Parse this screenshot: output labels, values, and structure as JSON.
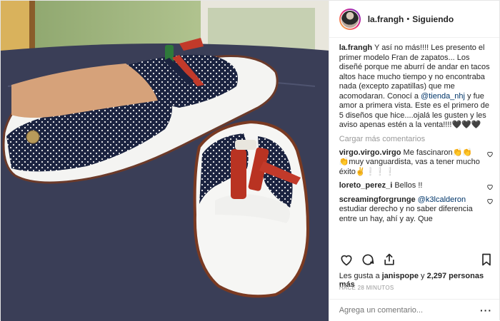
{
  "header": {
    "username": "la.frangh",
    "separator": "•",
    "follow_status": "Siguiendo"
  },
  "caption": {
    "username": "la.frangh",
    "text_1": "Y así no más!!!! Les presento el primer modelo Fran de zapatos... Los diseñé porque me aburrí de andar en tacos altos hace mucho tiempo y no encontraba nada (excepto zapatillas) que me acomodaran. Conocí a ",
    "mention": "@tienda_nhj",
    "text_2": " y fue amor a primera vista. Este es el primero de 5 diseños que hice....ojalá les gusten y les aviso apenas estén a la venta!!!!🖤🖤🖤"
  },
  "load_more": "Cargar más comentarios",
  "comments": [
    {
      "user": "virgo.virgo.virgo",
      "text": "Me fascinaron👏👏👏muy vanguardista, vas a tener mucho éxito✌️❕❕❕"
    },
    {
      "user": "loreto_perez_i",
      "text": "Bellos !!"
    },
    {
      "user": "screamingforgrunge",
      "mention": "@k3lcalderon",
      "text": "estudiar derecho y no saber diferencia entre un hay, ahí y ay. Que"
    }
  ],
  "likes": {
    "prefix": "Les gusta a ",
    "user": "janispope",
    "middle": " y ",
    "count": "2,297 personas más"
  },
  "timestamp": "HACE 28 MINUTOS",
  "add_comment": {
    "placeholder": "Agrega un comentario..."
  },
  "icons": [
    "heart-icon",
    "comment-icon",
    "share-icon",
    "bookmark-icon",
    "more-options-icon"
  ],
  "colors": {
    "link": "#003569",
    "muted": "#999999",
    "text": "#262626",
    "border": "#efefef"
  }
}
